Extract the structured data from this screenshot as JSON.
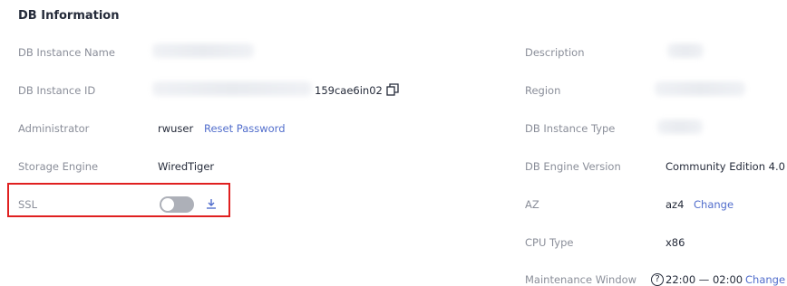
{
  "section": {
    "title": "DB Information"
  },
  "left": {
    "instance_name": {
      "label": "DB Instance Name"
    },
    "instance_id": {
      "label": "DB Instance ID",
      "value_suffix": "159cae6in02"
    },
    "administrator": {
      "label": "Administrator",
      "value": "rwuser",
      "action": "Reset Password"
    },
    "storage_engine": {
      "label": "Storage Engine",
      "value": "WiredTiger"
    },
    "ssl": {
      "label": "SSL",
      "enabled": false
    }
  },
  "right": {
    "description": {
      "label": "Description"
    },
    "region": {
      "label": "Region"
    },
    "instance_type": {
      "label": "DB Instance Type"
    },
    "engine_version": {
      "label": "DB Engine Version",
      "value": "Community Edition 4.0"
    },
    "az": {
      "label": "AZ",
      "value": "az4",
      "action": "Change"
    },
    "cpu_type": {
      "label": "CPU Type",
      "value": "x86"
    },
    "maintenance": {
      "label": "Maintenance Window",
      "help": "?",
      "value": "22:00 — 02:00",
      "action": "Change"
    }
  },
  "icons": {
    "copy": "copy-icon",
    "download": "download-icon",
    "help": "question-circle-icon"
  },
  "colors": {
    "link": "#526ecc",
    "label": "#8a8e99",
    "text": "#252b3a",
    "toggle_off": "#adb0b8",
    "highlight": "#e02020"
  }
}
